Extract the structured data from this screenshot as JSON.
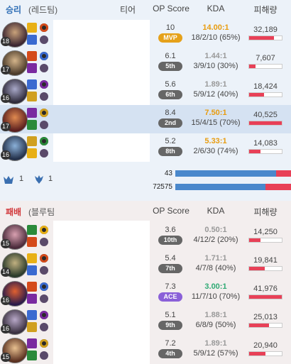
{
  "columns": {
    "tier": "티어",
    "op": "OP Score",
    "kda": "KDA",
    "dmg": "피해량"
  },
  "win": {
    "result": "승리",
    "team": "(레드팀)",
    "players": [
      {
        "level": "18",
        "op": "10",
        "badge": "MVP",
        "ratio": "14.00:1",
        "kda": "18/2/10 (65%)",
        "dmg": "32,189",
        "pct": 0.77,
        "ratio_color": "orange",
        "highlight": false
      },
      {
        "level": "17",
        "op": "6.1",
        "badge": "5th",
        "ratio": "1.44:1",
        "kda": "3/9/10 (30%)",
        "dmg": "7,607",
        "pct": 0.19,
        "ratio_color": "gray",
        "highlight": false
      },
      {
        "level": "16",
        "op": "5.6",
        "badge": "6th",
        "ratio": "1.89:1",
        "kda": "5/9/12 (40%)",
        "dmg": "18,424",
        "pct": 0.45,
        "ratio_color": "gray",
        "highlight": false
      },
      {
        "level": "17",
        "op": "8.4",
        "badge": "2nd",
        "ratio": "7.50:1",
        "kda": "15/4/15 (70%)",
        "dmg": "40,525",
        "pct": 1.0,
        "ratio_color": "orange",
        "highlight": true
      },
      {
        "level": "16",
        "op": "5.2",
        "badge": "8th",
        "ratio": "5.33:1",
        "kda": "2/6/30 (74%)",
        "dmg": "14,083",
        "pct": 0.35,
        "ratio_color": "orange",
        "highlight": false
      }
    ],
    "objectives": {
      "baron": "1",
      "dragon": "1"
    },
    "team_bars": [
      {
        "label": "43",
        "blue": 0.87
      },
      {
        "label": "72575",
        "blue": 0.78
      }
    ]
  },
  "lose": {
    "result": "패배",
    "team": "(블루팀",
    "players": [
      {
        "level": "15",
        "op": "3.6",
        "badge": "10th",
        "ratio": "0.50:1",
        "kda": "4/12/2 (20%)",
        "dmg": "14,250",
        "pct": 0.34,
        "ratio_color": "gray",
        "highlight": false
      },
      {
        "level": "14",
        "op": "5.4",
        "badge": "7th",
        "ratio": "1.71:1",
        "kda": "4/7/8 (40%)",
        "dmg": "19,841",
        "pct": 0.47,
        "ratio_color": "gray",
        "highlight": false
      },
      {
        "level": "16",
        "op": "7.3",
        "badge": "ACE",
        "ratio": "3.00:1",
        "kda": "11/7/10 (70%)",
        "dmg": "41,976",
        "pct": 1.0,
        "ratio_color": "green",
        "highlight": false
      },
      {
        "level": "16",
        "op": "5.1",
        "badge": "9th",
        "ratio": "1.88:1",
        "kda": "6/8/9 (50%)",
        "dmg": "25,013",
        "pct": 0.6,
        "ratio_color": "gray",
        "highlight": false
      },
      {
        "level": "15",
        "op": "7.2",
        "badge": "4th",
        "ratio": "1.89:1",
        "kda": "5/9/12 (57%)",
        "dmg": "20,940",
        "pct": 0.5,
        "ratio_color": "gray",
        "highlight": false
      }
    ]
  },
  "colors": {
    "win_bg": "#ecf2f9",
    "lose_bg": "#f3eeee",
    "win_text": "#2d6db5",
    "lose_text": "#d13639",
    "mvp": "#e5a11a",
    "ace": "#8a60d8",
    "damage": "#e84057",
    "blue_team": "#4a88cc"
  }
}
